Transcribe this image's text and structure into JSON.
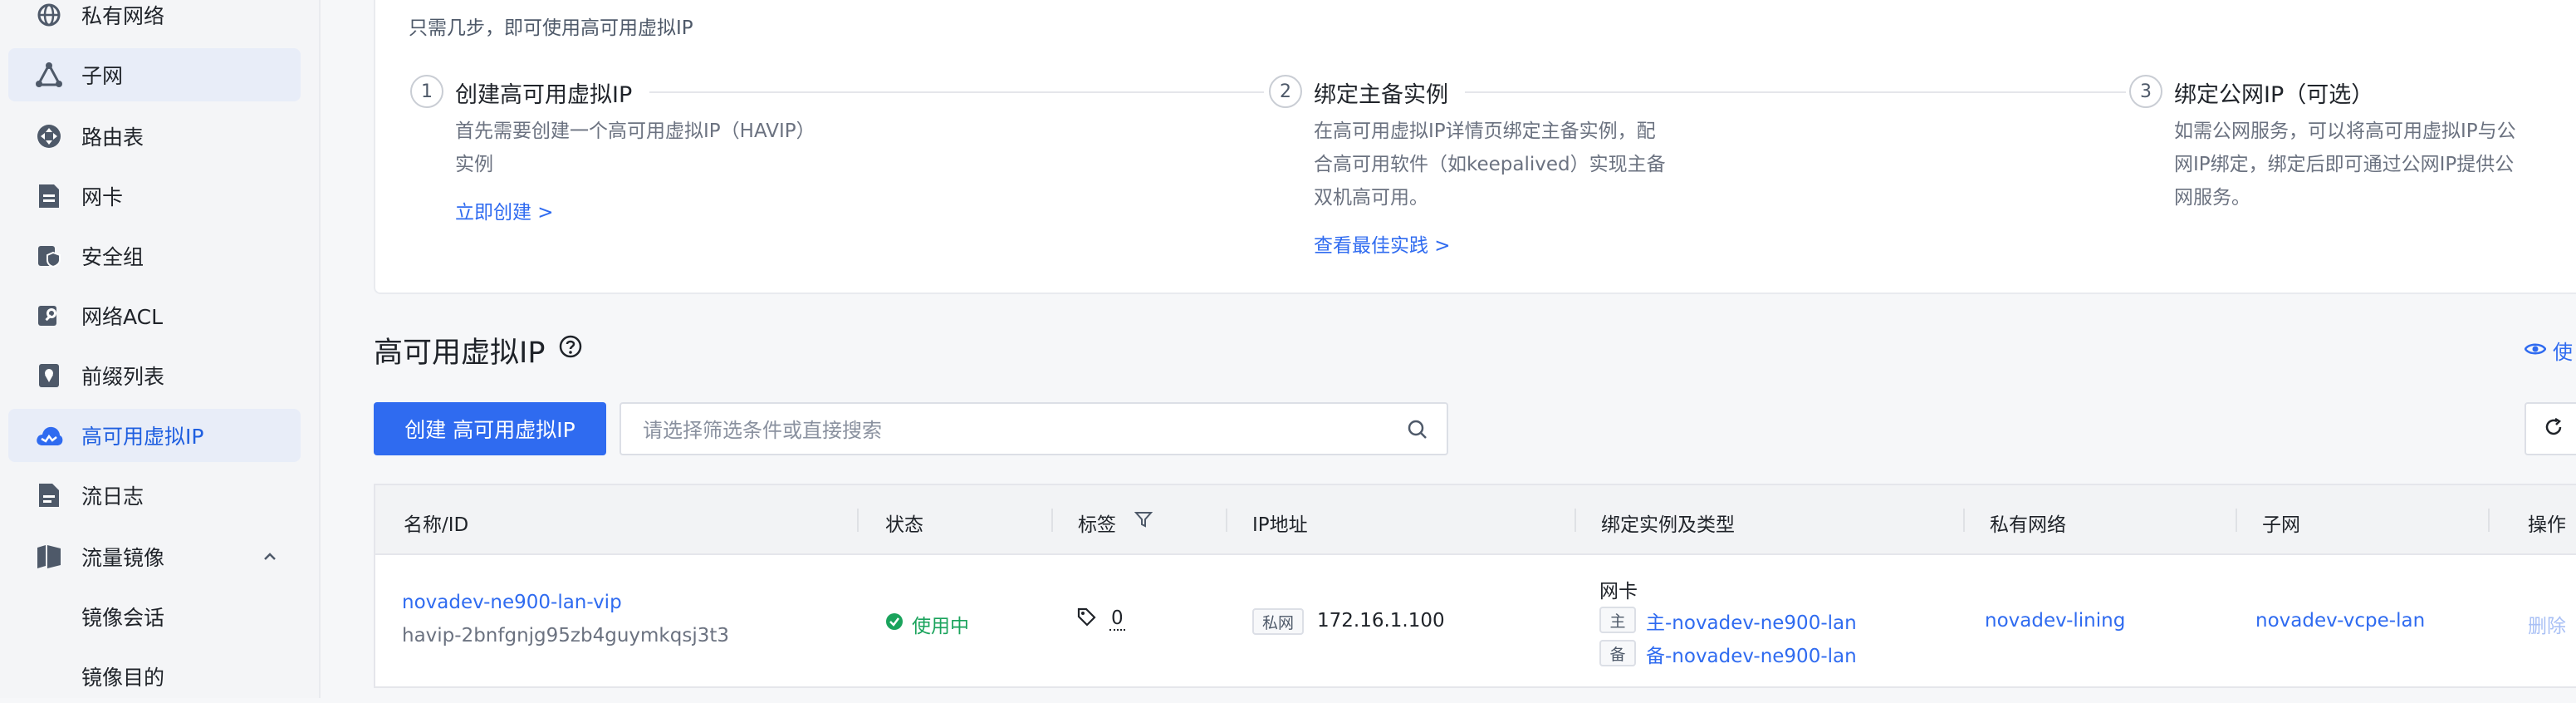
{
  "sidebar": {
    "items": [
      {
        "label": "私有网络",
        "icon": "globe-icon"
      },
      {
        "label": "子网",
        "icon": "subnet-icon"
      },
      {
        "label": "路由表",
        "icon": "route-icon"
      },
      {
        "label": "网卡",
        "icon": "nic-icon"
      },
      {
        "label": "安全组",
        "icon": "shield-icon"
      },
      {
        "label": "网络ACL",
        "icon": "acl-key-icon"
      },
      {
        "label": "前缀列表",
        "icon": "prefix-list-icon"
      },
      {
        "label": "高可用虚拟IP",
        "icon": "havip-cloud-icon"
      },
      {
        "label": "流日志",
        "icon": "log-icon"
      },
      {
        "label": "流量镜像",
        "icon": "mirror-icon"
      },
      {
        "label": "镜像会话"
      },
      {
        "label": "镜像目的"
      }
    ],
    "active_index": 7,
    "selected_hover_index": 1
  },
  "intro": "只需几步，即可使用高可用虚拟IP",
  "steps": [
    {
      "num": "1",
      "title": "创建高可用虚拟IP",
      "desc_lines": [
        "首先需要创建一个高可用虚拟IP（HAVIP）",
        "实例"
      ],
      "link": "立即创建 >"
    },
    {
      "num": "2",
      "title": "绑定主备实例",
      "desc_lines": [
        "在高可用虚拟IP详情页绑定主备实例，配",
        "合高可用软件（如keepalived）实现主备",
        "双机高可用。"
      ],
      "link": "查看最佳实践 >"
    },
    {
      "num": "3",
      "title": "绑定公网IP（可选）",
      "desc_lines": [
        "如需公网服务，可以将高可用虚拟IP与公",
        "网IP绑定，绑定后即可通过公网IP提供公",
        "网服务。"
      ]
    }
  ],
  "section_title": "高可用虚拟IP",
  "usage_link": "使",
  "toolbar": {
    "create_label": "创建 高可用虚拟IP",
    "search_placeholder": "请选择筛选条件或直接搜索"
  },
  "table": {
    "columns": [
      "名称/ID",
      "状态",
      "标签",
      "IP地址",
      "绑定实例及类型",
      "私有网络",
      "子网",
      "操作"
    ],
    "rows": [
      {
        "name": "novadev-ne900-lan-vip",
        "id": "havip-2bnfgnjg95zb4guymkqsj3t3",
        "status": "使用中",
        "tag_count": "0",
        "ip_type": "私网",
        "ip": "172.16.1.100",
        "instance_type": "网卡",
        "primary_tag": "主",
        "primary": "主-novadev-ne900-lan",
        "backup_tag": "备",
        "backup": "备-novadev-ne900-lan",
        "vpc": "novadev-lining",
        "subnet": "novadev-vcpe-lan",
        "action": "删除"
      }
    ]
  },
  "colors": {
    "accent": "#2f6bf0",
    "success": "#1aa35c",
    "active_bg": "#e8edf8"
  }
}
